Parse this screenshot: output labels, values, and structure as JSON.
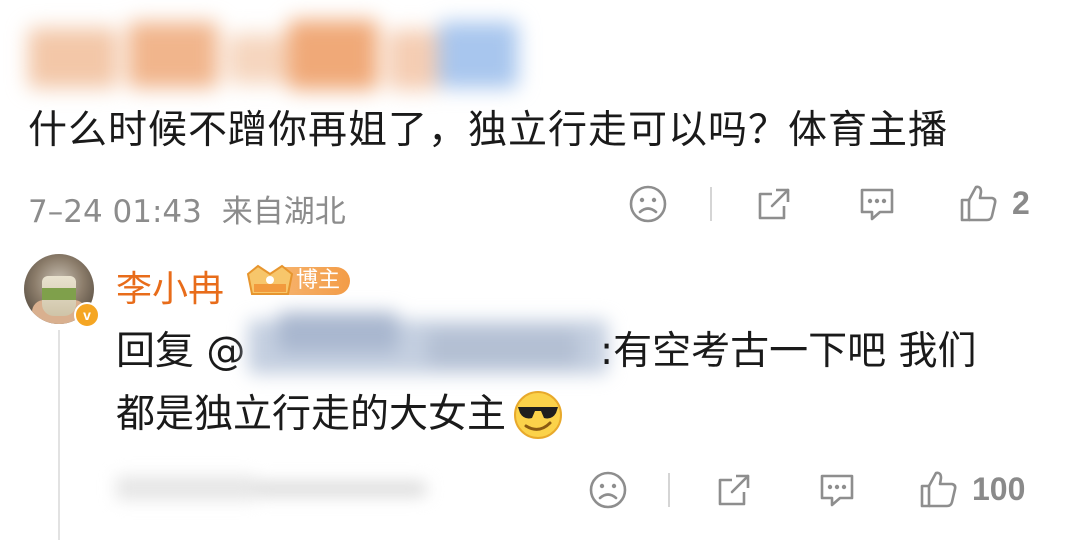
{
  "comment": {
    "text": "什么时候不蹭你再姐了，独立行走可以吗？体育主播",
    "time": "7–24 01:43",
    "location": "来自湖北",
    "like_count": "2"
  },
  "reply": {
    "author": "李小冉",
    "badge": "博主",
    "prefix": "回复 @",
    "text_line1": ":有空考古一下吧 我们",
    "text_line2": "都是独立行走的大女主",
    "emoji": "cool-sunglasses-emoji",
    "like_count": "100"
  },
  "colors": {
    "author_name": "#e86c1a",
    "badge_bg": "#f39c47",
    "text": "#1a1a1a",
    "meta": "#8c8c8c",
    "icon": "#8e8e8e"
  },
  "icons": {
    "dislike": "frown-face-icon",
    "share": "share-icon",
    "comment": "comment-bubble-icon",
    "like": "thumbs-up-icon"
  }
}
